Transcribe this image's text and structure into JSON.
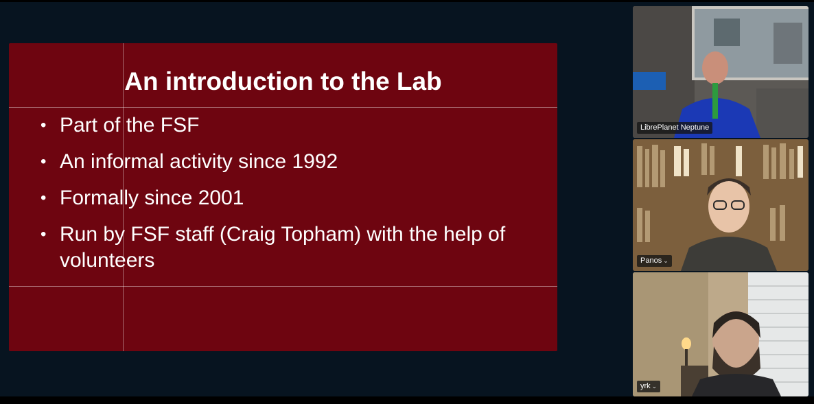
{
  "slide": {
    "title": "An introduction to the Lab",
    "bullets": [
      {
        "text": "Part of the FSF"
      },
      {
        "text": "An informal activity since 1992"
      },
      {
        "text": "Formally since 2001"
      },
      {
        "text": "Run by FSF staff (Craig Topham) with the help of volunteers"
      }
    ],
    "background_color": "#6e0510"
  },
  "participants": [
    {
      "name": "LibrePlanet Neptune",
      "menu_icon": ""
    },
    {
      "name": "Panos",
      "menu_icon": "chevron-down-icon"
    },
    {
      "name": "yrk",
      "menu_icon": "chevron-down-icon"
    }
  ],
  "glyphs": {
    "bullet": "•",
    "chevron": "⌄"
  },
  "colors": {
    "background": "#071420",
    "slide": "#6e0510"
  }
}
